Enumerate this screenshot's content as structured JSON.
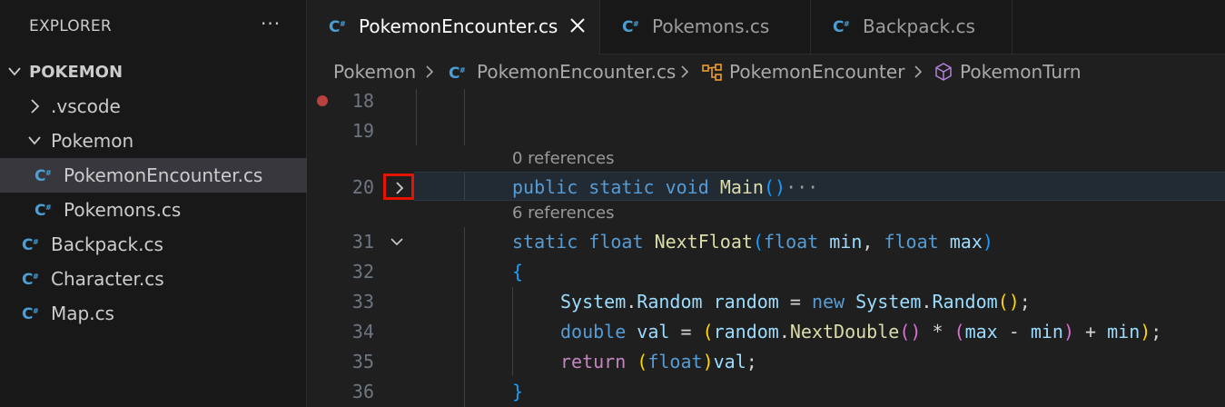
{
  "explorer": {
    "title": "EXPLORER",
    "more_icon": "ellipsis-icon",
    "tree": [
      {
        "label": "POKEMON",
        "kind": "root-folder",
        "expanded": true
      },
      {
        "label": ".vscode",
        "kind": "folder",
        "expanded": false
      },
      {
        "label": "Pokemon",
        "kind": "folder",
        "expanded": true
      },
      {
        "label": "PokemonEncounter.cs",
        "kind": "csharp-file",
        "selected": true
      },
      {
        "label": "Pokemons.cs",
        "kind": "csharp-file"
      },
      {
        "label": "Backpack.cs",
        "kind": "csharp-file"
      },
      {
        "label": "Character.cs",
        "kind": "csharp-file"
      },
      {
        "label": "Map.cs",
        "kind": "csharp-file"
      }
    ]
  },
  "tabs": [
    {
      "label": "PokemonEncounter.cs",
      "active": true
    },
    {
      "label": "Pokemons.cs",
      "active": false
    },
    {
      "label": "Backpack.cs",
      "active": false
    }
  ],
  "breadcrumb": [
    {
      "label": "Pokemon",
      "icon": ""
    },
    {
      "label": "PokemonEncounter.cs",
      "icon": "csharp-icon"
    },
    {
      "label": "PokemonEncounter",
      "icon": "class-icon"
    },
    {
      "label": "PokemonTurn",
      "icon": "method-cube-icon"
    }
  ],
  "editor": {
    "colors": {
      "keyword": "#569cd6",
      "function": "#dcdcaa",
      "variable": "#9cdcfe",
      "control": "#c586c0",
      "type": "#4ec9b0",
      "breakpoint": "#b8423d",
      "highlight_box": "#e51400"
    },
    "lines": [
      {
        "number": "18",
        "breakpoint": true,
        "tokens": []
      },
      {
        "number": "19",
        "tokens": []
      },
      {
        "number": "20",
        "codelens": "0 references",
        "folded": true,
        "tokens": [
          {
            "t": "public",
            "c": "kw"
          },
          {
            "t": " ",
            "c": "plain"
          },
          {
            "t": "static",
            "c": "kw"
          },
          {
            "t": " ",
            "c": "plain"
          },
          {
            "t": "void",
            "c": "kw"
          },
          {
            "t": " ",
            "c": "plain"
          },
          {
            "t": "Main",
            "c": "fn"
          },
          {
            "t": "()",
            "c": "brace-b"
          },
          {
            "t": "···",
            "c": "plain"
          }
        ]
      },
      {
        "number": "31",
        "codelens": "6 references",
        "foldable": true,
        "tokens": [
          {
            "t": "static",
            "c": "kw"
          },
          {
            "t": " ",
            "c": "plain"
          },
          {
            "t": "float",
            "c": "kw"
          },
          {
            "t": " ",
            "c": "plain"
          },
          {
            "t": "NextFloat",
            "c": "fn"
          },
          {
            "t": "(",
            "c": "brace-b"
          },
          {
            "t": "float",
            "c": "kw"
          },
          {
            "t": " ",
            "c": "plain"
          },
          {
            "t": "min",
            "c": "var"
          },
          {
            "t": ", ",
            "c": "plain"
          },
          {
            "t": "float",
            "c": "kw"
          },
          {
            "t": " ",
            "c": "plain"
          },
          {
            "t": "max",
            "c": "var"
          },
          {
            "t": ")",
            "c": "brace-b"
          }
        ]
      },
      {
        "number": "32",
        "tokens": [
          {
            "t": "{",
            "c": "brace-b"
          }
        ]
      },
      {
        "number": "33",
        "tokens": [
          {
            "t": "System",
            "c": "var"
          },
          {
            "t": ".",
            "c": "plain"
          },
          {
            "t": "Random",
            "c": "var"
          },
          {
            "t": " ",
            "c": "plain"
          },
          {
            "t": "random",
            "c": "var"
          },
          {
            "t": " = ",
            "c": "plain"
          },
          {
            "t": "new",
            "c": "kw"
          },
          {
            "t": " ",
            "c": "plain"
          },
          {
            "t": "System",
            "c": "var"
          },
          {
            "t": ".",
            "c": "plain"
          },
          {
            "t": "Random",
            "c": "var"
          },
          {
            "t": "()",
            "c": "brace-y"
          },
          {
            "t": ";",
            "c": "plain"
          }
        ]
      },
      {
        "number": "34",
        "tokens": [
          {
            "t": "double",
            "c": "kw"
          },
          {
            "t": " ",
            "c": "plain"
          },
          {
            "t": "val",
            "c": "var"
          },
          {
            "t": " = ",
            "c": "plain"
          },
          {
            "t": "(",
            "c": "brace-y"
          },
          {
            "t": "random",
            "c": "var"
          },
          {
            "t": ".",
            "c": "plain"
          },
          {
            "t": "NextDouble",
            "c": "fn"
          },
          {
            "t": "()",
            "c": "brace-p"
          },
          {
            "t": " * ",
            "c": "plain"
          },
          {
            "t": "(",
            "c": "brace-p"
          },
          {
            "t": "max",
            "c": "var"
          },
          {
            "t": " - ",
            "c": "plain"
          },
          {
            "t": "min",
            "c": "var"
          },
          {
            "t": ")",
            "c": "brace-p"
          },
          {
            "t": " + ",
            "c": "plain"
          },
          {
            "t": "min",
            "c": "var"
          },
          {
            "t": ")",
            "c": "brace-y"
          },
          {
            "t": ";",
            "c": "plain"
          }
        ]
      },
      {
        "number": "35",
        "tokens": [
          {
            "t": "return",
            "c": "kw2"
          },
          {
            "t": " ",
            "c": "plain"
          },
          {
            "t": "(",
            "c": "brace-y"
          },
          {
            "t": "float",
            "c": "kw"
          },
          {
            "t": ")",
            "c": "brace-y"
          },
          {
            "t": "val",
            "c": "var"
          },
          {
            "t": ";",
            "c": "plain"
          }
        ]
      },
      {
        "number": "36",
        "tokens": [
          {
            "t": "}",
            "c": "brace-b"
          }
        ]
      }
    ]
  }
}
